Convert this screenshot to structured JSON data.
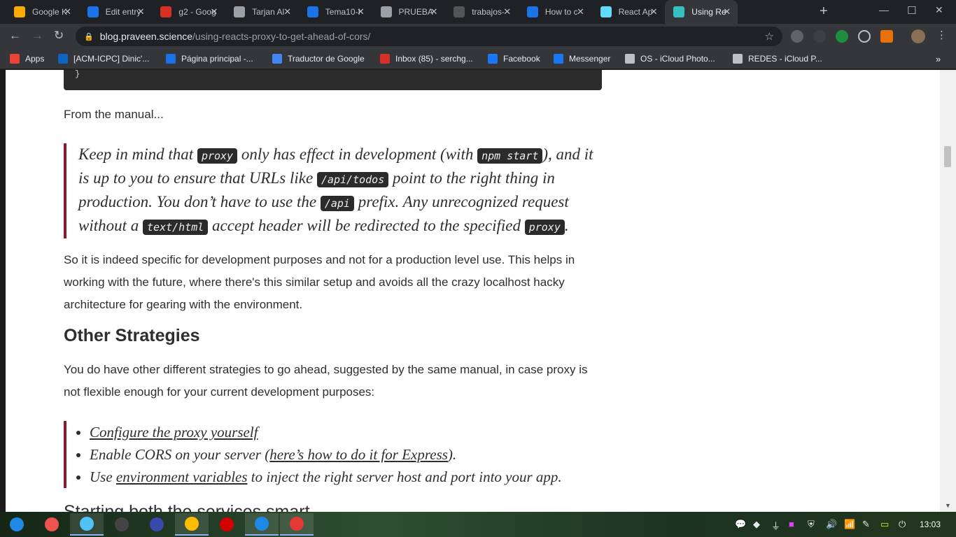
{
  "tabs": [
    {
      "title": "Google K",
      "favicon": "keep-icon",
      "color": "#f9ab00"
    },
    {
      "title": "Edit entry",
      "favicon": "sheet-icon",
      "color": "#1a73e8"
    },
    {
      "title": "g2 - Goog",
      "favicon": "slides-icon",
      "color": "#d93025"
    },
    {
      "title": "Tarjan Al",
      "favicon": "globe-icon",
      "color": "#9aa0a6"
    },
    {
      "title": "Tema10-I",
      "favicon": "dropbox-icon",
      "color": "#1a73e8"
    },
    {
      "title": "PRUEBA",
      "favicon": "globe-icon",
      "color": "#9aa0a6"
    },
    {
      "title": "trabajos-",
      "favicon": "github-icon",
      "color": "#555555"
    },
    {
      "title": "How to c",
      "favicon": "f-icon",
      "color": "#1a73e8"
    },
    {
      "title": "React Ap",
      "favicon": "react-icon",
      "color": "#61dafb"
    },
    {
      "title": "Using Re",
      "favicon": "cloud-icon",
      "color": "#34c0c0"
    }
  ],
  "address": {
    "host": "blog.praveen.science",
    "path": "/using-reacts-proxy-to-get-ahead-of-cors/"
  },
  "bookmarks": [
    {
      "label": "Apps",
      "icon": "apps-grid-icon",
      "color": "#ea4335"
    },
    {
      "label": "[ACM-ICPC] Dinic'...",
      "icon": "linkedin-icon",
      "color": "#0a66c2"
    },
    {
      "label": "Página principal -...",
      "icon": "dropbox-icon",
      "color": "#1a73e8"
    },
    {
      "label": "Traductor de Google",
      "icon": "translate-icon",
      "color": "#4285f4"
    },
    {
      "label": "Inbox (85) - serchg...",
      "icon": "gmail-icon",
      "color": "#d93025"
    },
    {
      "label": "Facebook",
      "icon": "facebook-icon",
      "color": "#1877f2"
    },
    {
      "label": "Messenger",
      "icon": "facebook-icon",
      "color": "#1877f2"
    },
    {
      "label": "OS - iCloud Photo...",
      "icon": "apple-icon",
      "color": "#bdc1c6"
    },
    {
      "label": "REDES - iCloud P...",
      "icon": "apple-icon",
      "color": "#bdc1c6"
    }
  ],
  "article": {
    "code_tail": "}",
    "from_manual": "From the manual...",
    "quote": {
      "t1": "Keep in mind that ",
      "c1": "proxy",
      "t2": " only has effect in development (with ",
      "c2": "npm start",
      "t3": "), and it is up to you to ensure that URLs like ",
      "c3": "/api/todos",
      "t4": " point to the right thing in production. You don’t have to use the ",
      "c4": "/api",
      "t5": " prefix. Any unrecognized request without a ",
      "c5": "text/html",
      "t6": " accept header will be redirected to the specified ",
      "c6": "proxy",
      "t7": "."
    },
    "para1": "So it is indeed specific for development purposes and not for a production level use. This helps in working with the future, where there's this similar setup and avoids all the crazy localhost hacky architecture for gearing with the environment.",
    "heading": "Other Strategies",
    "para2": "You do have other different strategies to go ahead, suggested by the same manual, in case proxy is not flexible enough for your current development purposes:",
    "list": {
      "item1_link": "Configure the proxy yourself",
      "item2_pre": "Enable CORS on your server (",
      "item2_link": "here’s how to do it for Express",
      "item2_post": ").",
      "item3_pre": "Use ",
      "item3_link": "environment variables",
      "item3_post": " to inject the right server host and port into your app."
    },
    "next_heading_partial": "Starting both the services smart..."
  },
  "taskbar": {
    "apps": [
      {
        "name": "start-icon",
        "color": "#1e88e5"
      },
      {
        "name": "record-icon",
        "color": "#ef5350"
      },
      {
        "name": "files-icon",
        "color": "#4fc3f7"
      },
      {
        "name": "s-icon",
        "color": "#444444"
      },
      {
        "name": "monitor-icon",
        "color": "#3949ab"
      },
      {
        "name": "chrome-icon",
        "color": "#fbbc04"
      },
      {
        "name": "opera-icon",
        "color": "#d50000"
      },
      {
        "name": "vscode-icon",
        "color": "#1e88e5"
      },
      {
        "name": "terminal-icon",
        "color": "#e53935"
      }
    ],
    "time": "13:03"
  }
}
